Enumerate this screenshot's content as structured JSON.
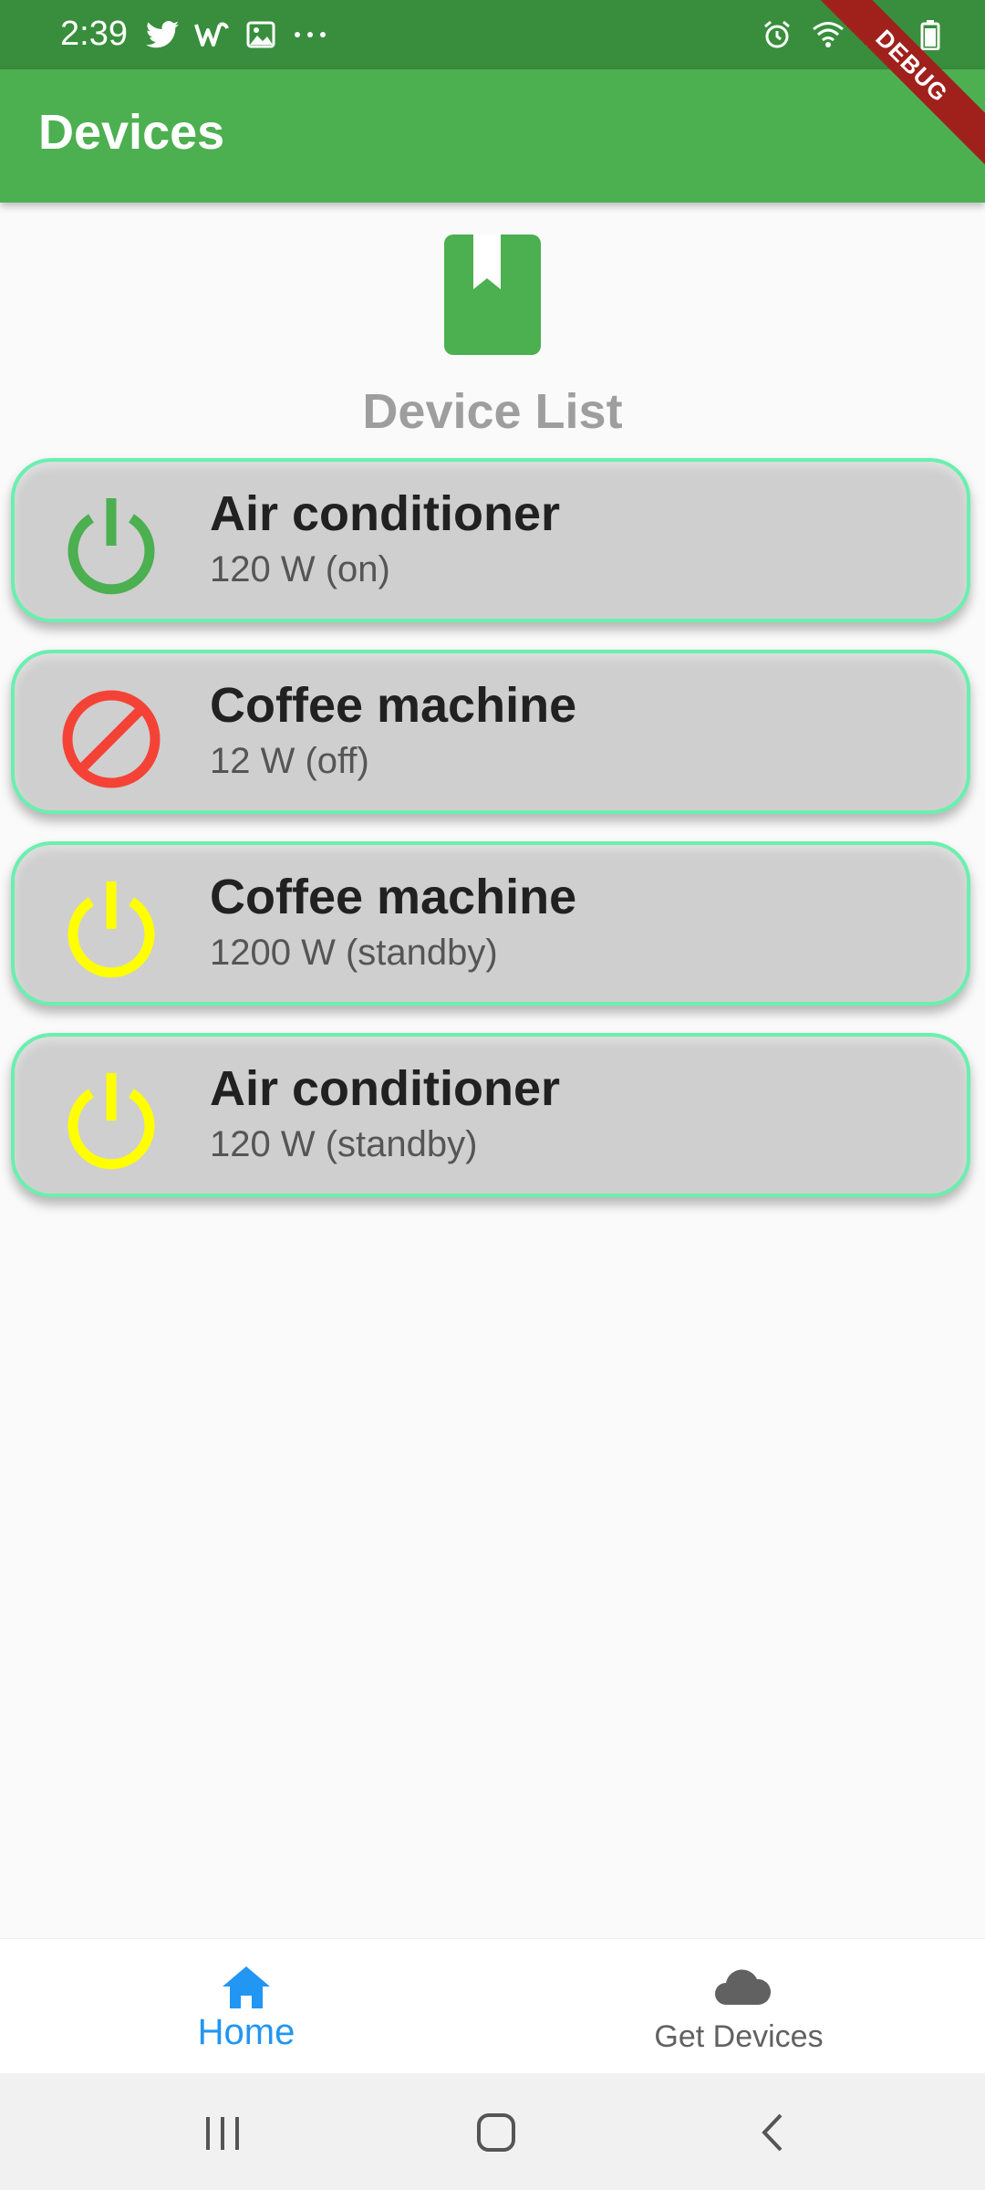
{
  "status_bar": {
    "time": "2:39",
    "left_icons": [
      "twitter-icon",
      "w-icon",
      "image-icon",
      "more-icon"
    ],
    "right_icons": [
      "alarm-icon",
      "wifi-icon",
      "signal-icon",
      "battery-icon"
    ],
    "debug_label": "DEBUG"
  },
  "app_bar": {
    "title": "Devices"
  },
  "header": {
    "icon": "bookmark-icon",
    "title": "Device List"
  },
  "devices": [
    {
      "name": "Air conditioner",
      "detail": "120 W (on)",
      "status": "on",
      "icon": "power-icon",
      "color": "#4caf50"
    },
    {
      "name": "Coffee machine",
      "detail": "12 W (off)",
      "status": "off",
      "icon": "block-icon",
      "color": "#f44336"
    },
    {
      "name": "Coffee machine",
      "detail": "1200 W (standby)",
      "status": "standby",
      "icon": "power-icon",
      "color": "#ffff00"
    },
    {
      "name": "Air conditioner",
      "detail": "120 W (standby)",
      "status": "standby",
      "icon": "power-icon",
      "color": "#ffff00"
    }
  ],
  "bottom_nav": {
    "items": [
      {
        "label": "Home",
        "icon": "home-icon",
        "active": true,
        "color": "#2196f3"
      },
      {
        "label": "Get Devices",
        "icon": "cloud-icon",
        "active": false,
        "color": "#757575"
      }
    ]
  },
  "system_nav": {
    "buttons": [
      "recents-icon",
      "home-circle-icon",
      "back-icon"
    ]
  },
  "colors": {
    "primary": "#4caf50",
    "status_bar": "#388e3c",
    "card_border": "#69f0ae",
    "card_bg": "#cfcfcf",
    "accent": "#2196f3"
  }
}
